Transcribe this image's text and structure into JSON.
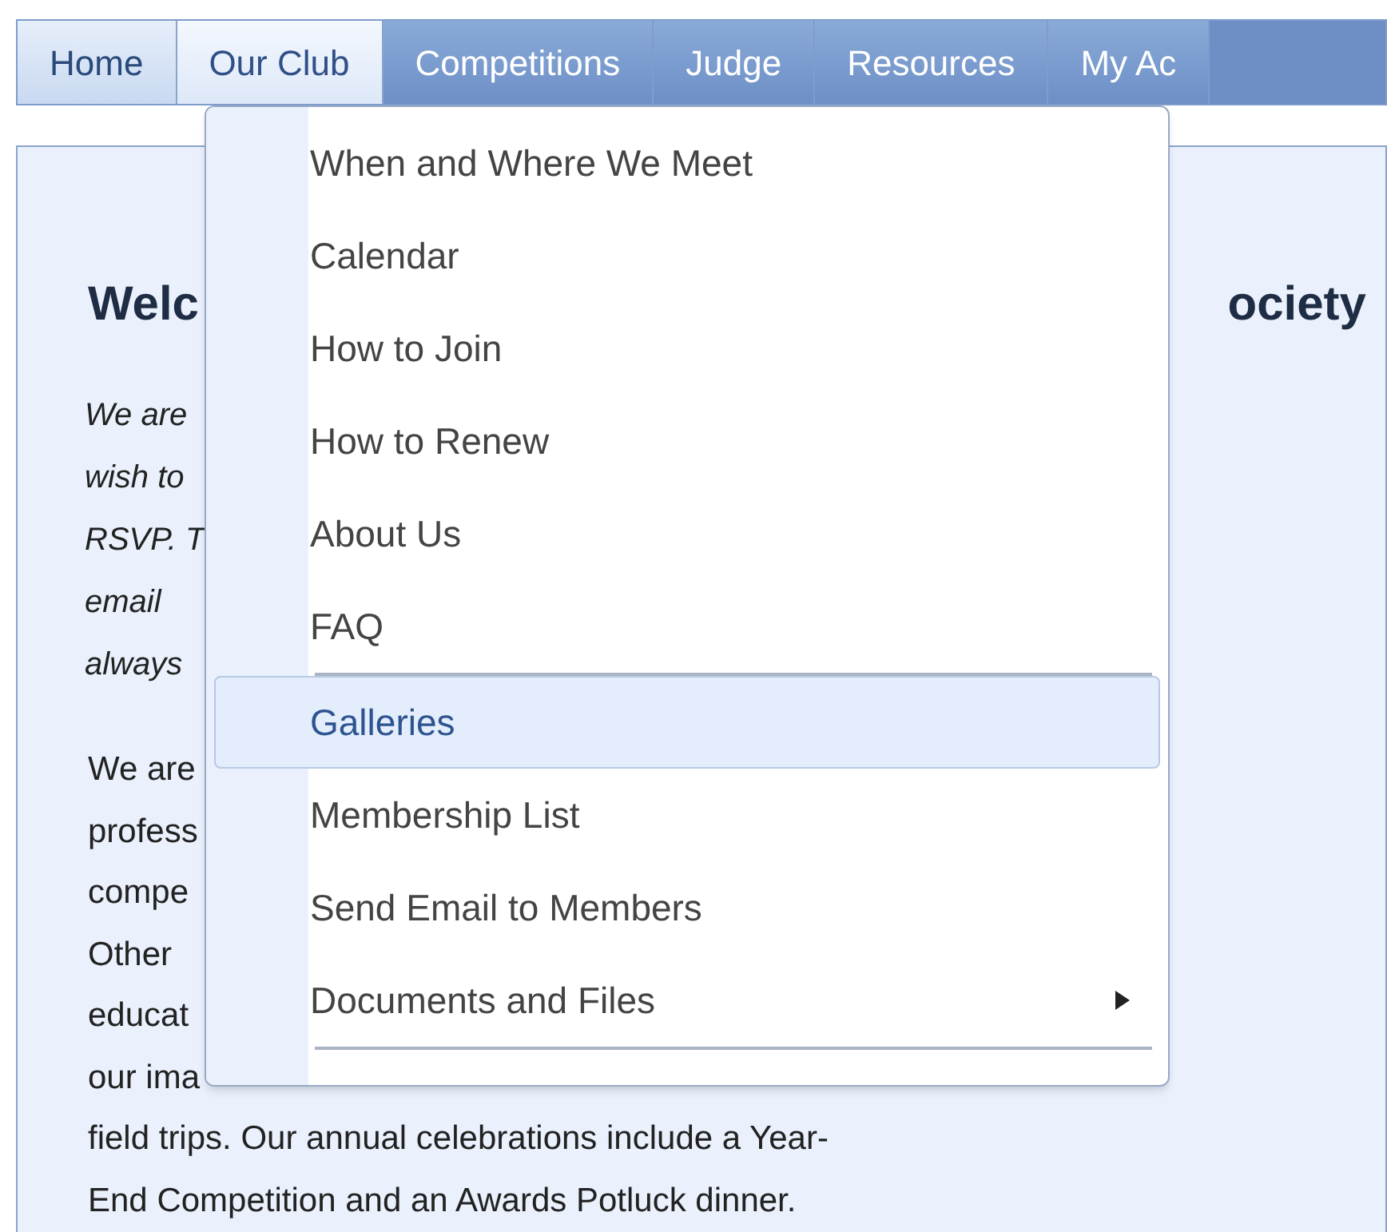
{
  "nav": {
    "items": [
      {
        "label": "Home",
        "selected": true,
        "open": false
      },
      {
        "label": "Our Club",
        "selected": false,
        "open": true
      },
      {
        "label": "Competitions",
        "selected": false,
        "open": false
      },
      {
        "label": "Judge",
        "selected": false,
        "open": false
      },
      {
        "label": "Resources",
        "selected": false,
        "open": false
      },
      {
        "label": "My Ac",
        "selected": false,
        "open": false
      }
    ]
  },
  "menu": {
    "items": [
      {
        "label": "When and Where We Meet",
        "selected": false,
        "submenu": false,
        "separator_after": false
      },
      {
        "label": "Calendar",
        "selected": false,
        "submenu": false,
        "separator_after": false
      },
      {
        "label": "How to Join",
        "selected": false,
        "submenu": false,
        "separator_after": false
      },
      {
        "label": "How to Renew",
        "selected": false,
        "submenu": false,
        "separator_after": false
      },
      {
        "label": "About Us",
        "selected": false,
        "submenu": false,
        "separator_after": false
      },
      {
        "label": "FAQ",
        "selected": false,
        "submenu": false,
        "separator_after": true
      },
      {
        "label": "Galleries",
        "selected": true,
        "submenu": false,
        "separator_after": false
      },
      {
        "label": "Membership List",
        "selected": false,
        "submenu": false,
        "separator_after": false
      },
      {
        "label": "Send Email to Members",
        "selected": false,
        "submenu": false,
        "separator_after": false
      },
      {
        "label": "Documents and Files",
        "selected": false,
        "submenu": true,
        "separator_after": true
      }
    ]
  },
  "content": {
    "heading_left": "Welc",
    "heading_right": "ociety",
    "intro_lines": [
      "We are",
      "wish to",
      "RSVP. T",
      "email",
      "always"
    ],
    "body_lines": [
      "We are",
      "profess",
      "compe",
      "Other",
      "educat",
      "our ima"
    ],
    "body_tail": [
      "field trips. Our annual celebrations include a Year-",
      "End Competition and an Awards Potluck dinner."
    ]
  }
}
